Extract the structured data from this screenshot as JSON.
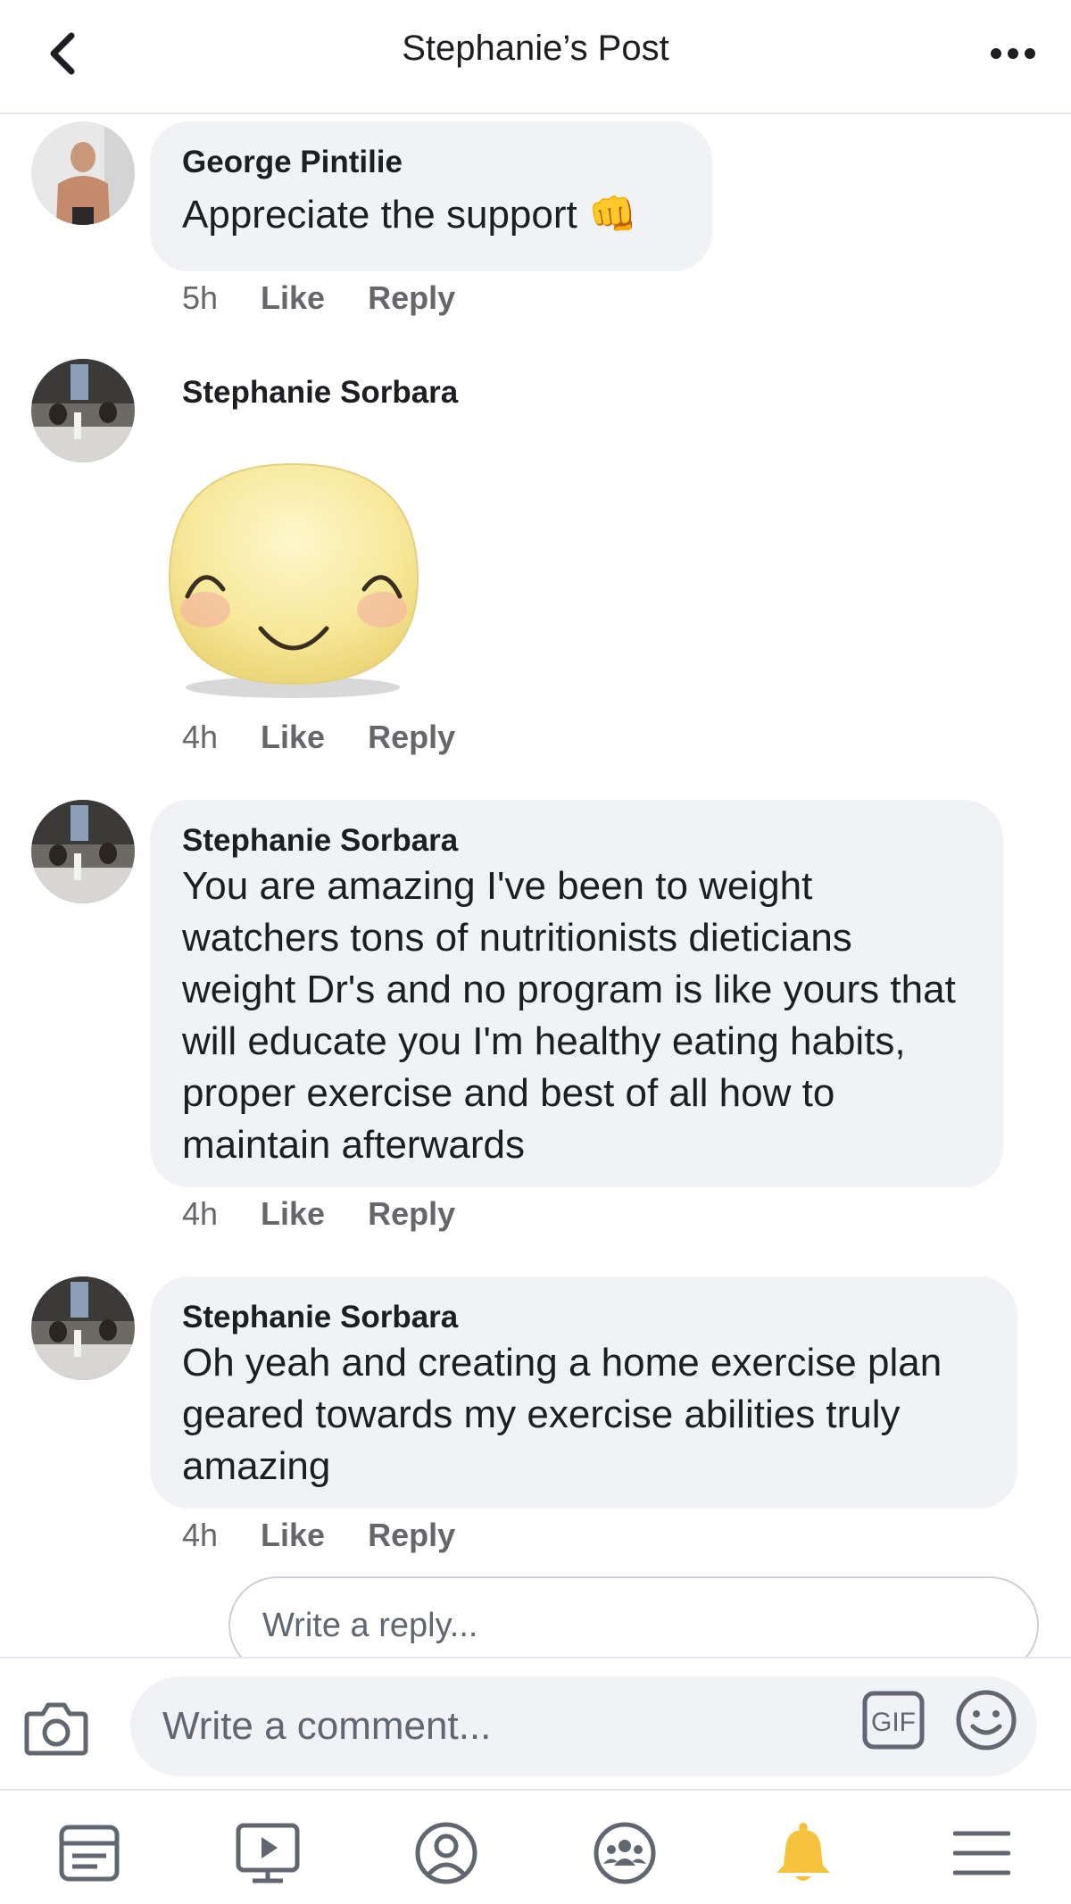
{
  "header": {
    "title": "Stephanie’s Post",
    "back_icon": "back-chevron-icon",
    "more_icon": "more-dots-icon"
  },
  "comments": [
    {
      "author": "George Pintilie",
      "text": "Appreciate the support 👊",
      "time": "5h",
      "like": "Like",
      "reply": "Reply"
    },
    {
      "author": "Stephanie Sorbara",
      "sticker": "smiling-emoji-sticker",
      "time": "4h",
      "like": "Like",
      "reply": "Reply"
    },
    {
      "author": "Stephanie Sorbara",
      "text": "You are amazing I've been to weight watchers tons of nutritionists dieticians weight Dr's and no program is like yours that will educate you I'm healthy eating habits, proper exercise and best of all how to maintain afterwards",
      "time": "4h",
      "like": "Like",
      "reply": "Reply"
    },
    {
      "author": "Stephanie Sorbara",
      "text": "Oh yeah and creating a home exercise plan geared towards my exercise abilities truly amazing",
      "time": "4h",
      "like": "Like",
      "reply": "Reply"
    }
  ],
  "reply_input": {
    "placeholder": "Write a reply..."
  },
  "comment_bar": {
    "placeholder": "Write a comment...",
    "camera_icon": "camera-icon",
    "gif_label": "GIF",
    "emoji_icon": "smiley-icon"
  },
  "bottom_nav": {
    "items": [
      "news-feed-icon",
      "watch-icon",
      "profile-icon",
      "groups-icon",
      "notifications-bell-icon",
      "menu-icon"
    ]
  },
  "colors": {
    "bubble": "#f0f2f5",
    "meta_text": "#65676b",
    "bell_active": "#f5c33b"
  }
}
